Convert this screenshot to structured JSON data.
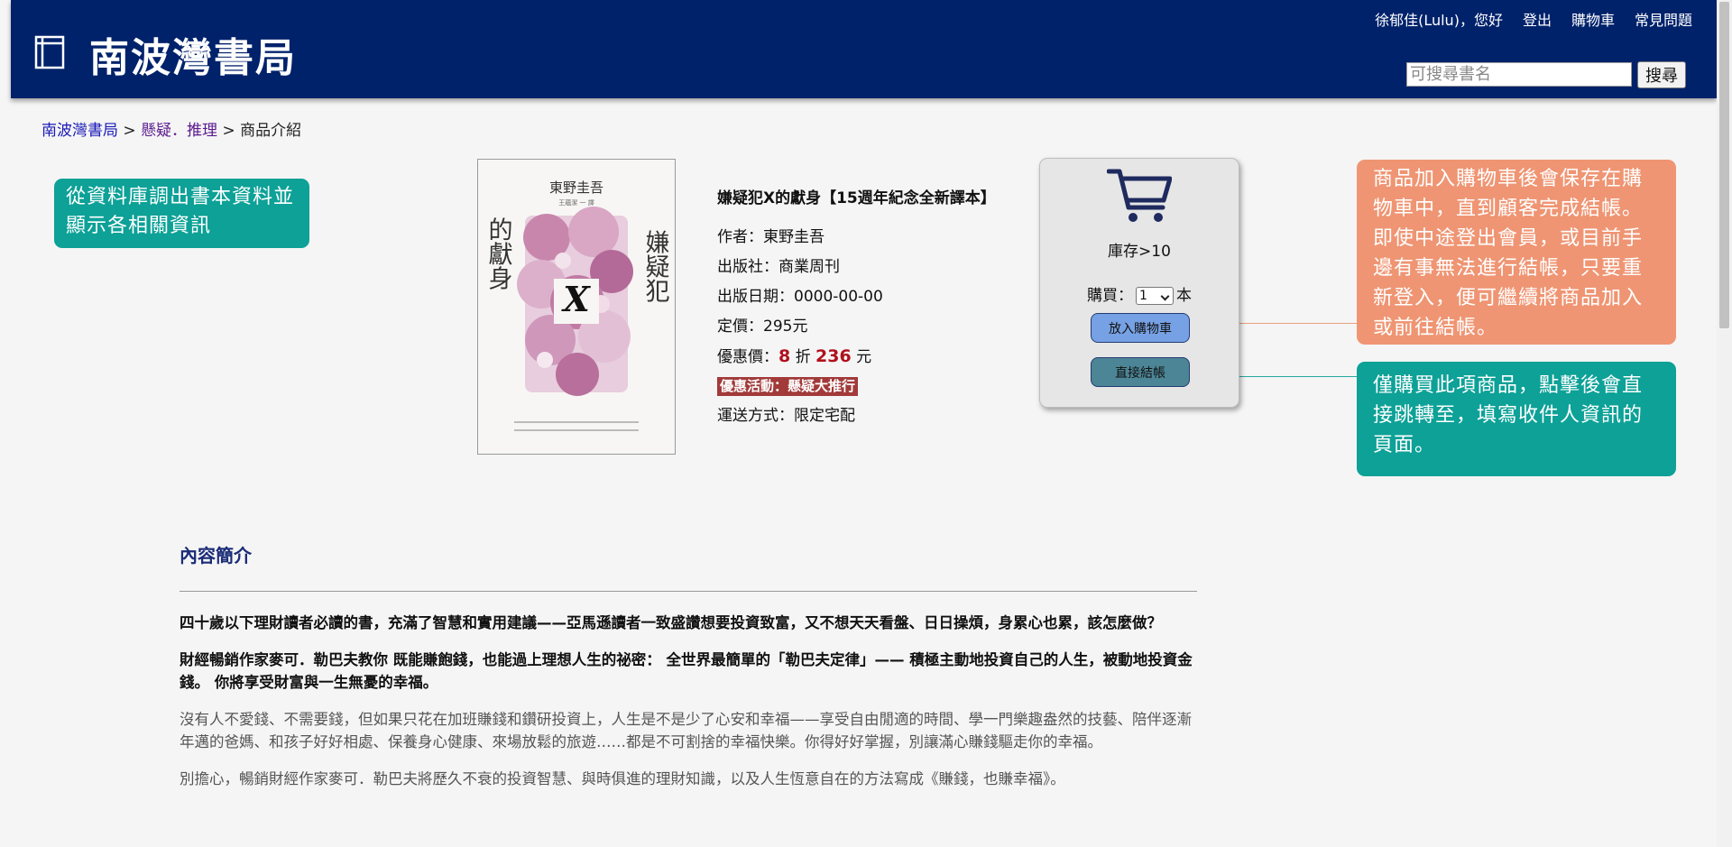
{
  "header": {
    "site_title": "南波灣書局",
    "user_greeting": "徐郁佳(Lulu)，您好",
    "logout": "登出",
    "cart": "購物車",
    "faq": "常見問題",
    "search_placeholder": "可搜尋書名",
    "search_button": "搜尋"
  },
  "breadcrumb": {
    "home": "南波灣書局",
    "sep": ">",
    "category": "懸疑．推理",
    "current": "商品介紹"
  },
  "callouts": {
    "database": "從資料庫調出書本資料並顯示各相關資訊",
    "cart": "商品加入購物車後會保存在購物車中，直到顧客完成結帳。即使中途登出會員，或目前手邊有事無法進行結帳，只要重新登入，便可繼續將商品加入或前往結帳。",
    "checkout": "僅購買此項商品，點擊後會直接跳轉至，填寫收件人資訊的頁面。"
  },
  "cover": {
    "author": "東野圭吾",
    "translator": "王蘊潔 一 譯",
    "title_right": "嫌疑犯",
    "title_left": "的獻身",
    "title_x": "X"
  },
  "book": {
    "title": "嫌疑犯X的獻身【15週年紀念全新譯本】",
    "author": "作者：東野圭吾",
    "publisher": "出版社：商業周刊",
    "pub_date": "出版日期：0000-00-00",
    "list_price": "定價：295元",
    "discount_label": "優惠價：",
    "discount_rate": "8",
    "discount_unit": "折",
    "discount_price": "236",
    "price_unit": "元",
    "promotion": "優惠活動：懸疑大推行",
    "shipping": "運送方式：限定宅配"
  },
  "purchase": {
    "stock": "庫存>10",
    "buy_label": "購買：",
    "qty": "1",
    "qty_unit": "本",
    "add_to_cart": "放入購物車",
    "checkout": "直接結帳"
  },
  "description": {
    "heading": "內容簡介",
    "p1": "四十歲以下理財讀者必讀的書，充滿了智慧和實用建議——亞馬遜讀者一致盛讚想要投資致富，又不想天天看盤、日日操煩，身累心也累，該怎麼做？",
    "p2": "財經暢銷作家麥可．勒巴夫教你 既能賺飽錢，也能過上理想人生的祕密： 全世界最簡單的「勒巴夫定律」—— 積極主動地投資自己的人生，被動地投資金錢。 你將享受財富與一生無憂的幸福。",
    "p3": "沒有人不愛錢、不需要錢，但如果只花在加班賺錢和鑽研投資上，人生是不是少了心安和幸福——享受自由閒適的時間、學一門樂趣盎然的技藝、陪伴逐漸年邁的爸媽、和孩子好好相處、保養身心健康、來場放鬆的旅遊……都是不可割捨的幸福快樂。你得好好掌握，別讓滿心賺錢驅走你的幸福。",
    "p4": "別擔心，暢銷財經作家麥可．勒巴夫將歷久不衰的投資智慧、與時俱進的理財知識，以及人生恆意自在的方法寫成《賺錢，也賺幸福》。"
  },
  "colors": {
    "header_bg": "#00226b",
    "teal_callout": "#0da197",
    "orange_callout": "#ef9573",
    "price_red": "#b0101c",
    "promo_bg": "#a23a3a",
    "add_cart_btn": "#76a1e4",
    "checkout_btn": "#4c8596"
  },
  "icons": [
    "book-logo-icon",
    "shopping-cart-icon",
    "chevron-down-icon"
  ]
}
